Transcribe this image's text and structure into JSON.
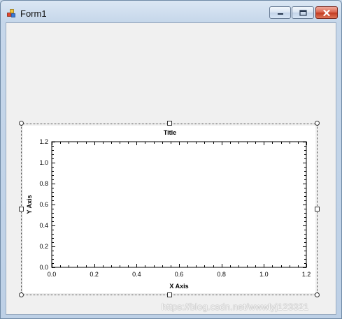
{
  "window": {
    "title": "Form1",
    "icon": "winforms-app-icon",
    "controls": {
      "minimize": "minimize-icon",
      "maximize": "maximize-icon",
      "close": "close-icon"
    }
  },
  "chart_data": {
    "type": "line",
    "title": "Title",
    "xlabel": "X Axis",
    "ylabel": "Y Axis",
    "xlim": [
      0.0,
      1.2
    ],
    "ylim": [
      0.0,
      1.2
    ],
    "x_ticks": [
      "0.0",
      "0.2",
      "0.4",
      "0.6",
      "0.8",
      "1.0",
      "1.2"
    ],
    "y_ticks": [
      "0.0",
      "0.2",
      "0.4",
      "0.6",
      "0.8",
      "1.0",
      "1.2"
    ],
    "grid": false,
    "series": []
  },
  "watermark": "https://blog.csdn.net/wwwlyj123321",
  "colors": {
    "plot_background": "#ffffff",
    "client_background": "#f0f0f0",
    "close_button": "#c2391f"
  }
}
